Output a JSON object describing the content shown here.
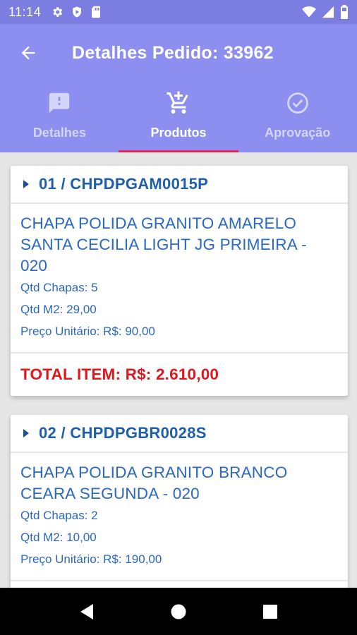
{
  "status_bar": {
    "time": "11:14",
    "icons_left": [
      "gear-icon",
      "shield-play-icon",
      "sd-card-icon"
    ],
    "icons_right": [
      "wifi-icon",
      "signal-icon",
      "battery-icon"
    ]
  },
  "header": {
    "title": "Detalhes Pedido: 33962",
    "back_icon": "arrow-left-icon"
  },
  "tabs": [
    {
      "label": "Detalhes",
      "icon": "alert-message-icon",
      "active": false
    },
    {
      "label": "Produtos",
      "icon": "cart-plus-icon",
      "active": true
    },
    {
      "label": "Aprovação",
      "icon": "check-circle-icon",
      "active": false
    }
  ],
  "items": [
    {
      "code": "01 / CHPDPGAM0015P",
      "name_lines": [
        "CHAPA POLIDA GRANITO AMARELO",
        "SANTA CECILIA LIGHT JG PRIMEIRA -",
        "020"
      ],
      "qtd_chapas": "Qtd Chapas: 5",
      "qtd_m2": "Qtd M2: 29,00",
      "preco": "Preço Unitário: R$: 90,00",
      "total": "TOTAL ITEM: R$: 2.610,00"
    },
    {
      "code": "02 / CHPDPGBR0028S",
      "name_lines": [
        "CHAPA POLIDA GRANITO BRANCO",
        "CEARA SEGUNDA - 020"
      ],
      "qtd_chapas": "Qtd Chapas: 2",
      "qtd_m2": "Qtd M2: 10,00",
      "preco": "Preço Unitário: R$: 190,00"
    }
  ],
  "nav_bar": [
    "back-triangle-icon",
    "home-circle-icon",
    "recents-square-icon"
  ],
  "colors": {
    "status_bar": "#7c7de0",
    "app_bar": "#8d8ff0",
    "tab_indicator": "#e8245a",
    "item_code": "#1d5fad",
    "text_blue": "#2a68c2",
    "total_red": "#e0181e",
    "background": "#e6e6e6"
  }
}
